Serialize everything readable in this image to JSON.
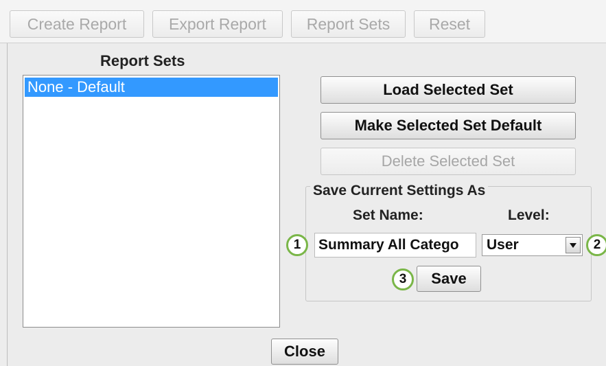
{
  "toolbar": {
    "create_report": "Create Report",
    "export_report": "Export Report",
    "report_sets": "Report Sets",
    "reset": "Reset"
  },
  "report_sets": {
    "heading": "Report Sets",
    "items": [
      {
        "label": "None - Default",
        "selected": true
      }
    ]
  },
  "actions": {
    "load_selected": "Load Selected Set",
    "make_default": "Make Selected Set Default",
    "delete_selected": "Delete Selected Set"
  },
  "save_group": {
    "title": "Save Current Settings As",
    "set_name_label": "Set Name:",
    "level_label": "Level:",
    "set_name_value": "Summary All Catego",
    "level_value": "User",
    "save_button": "Save"
  },
  "callouts": {
    "one": "1",
    "two": "2",
    "three": "3"
  },
  "footer": {
    "close_button": "Close"
  },
  "colors": {
    "selection": "#3399ff",
    "callout_ring": "#7ab648"
  }
}
